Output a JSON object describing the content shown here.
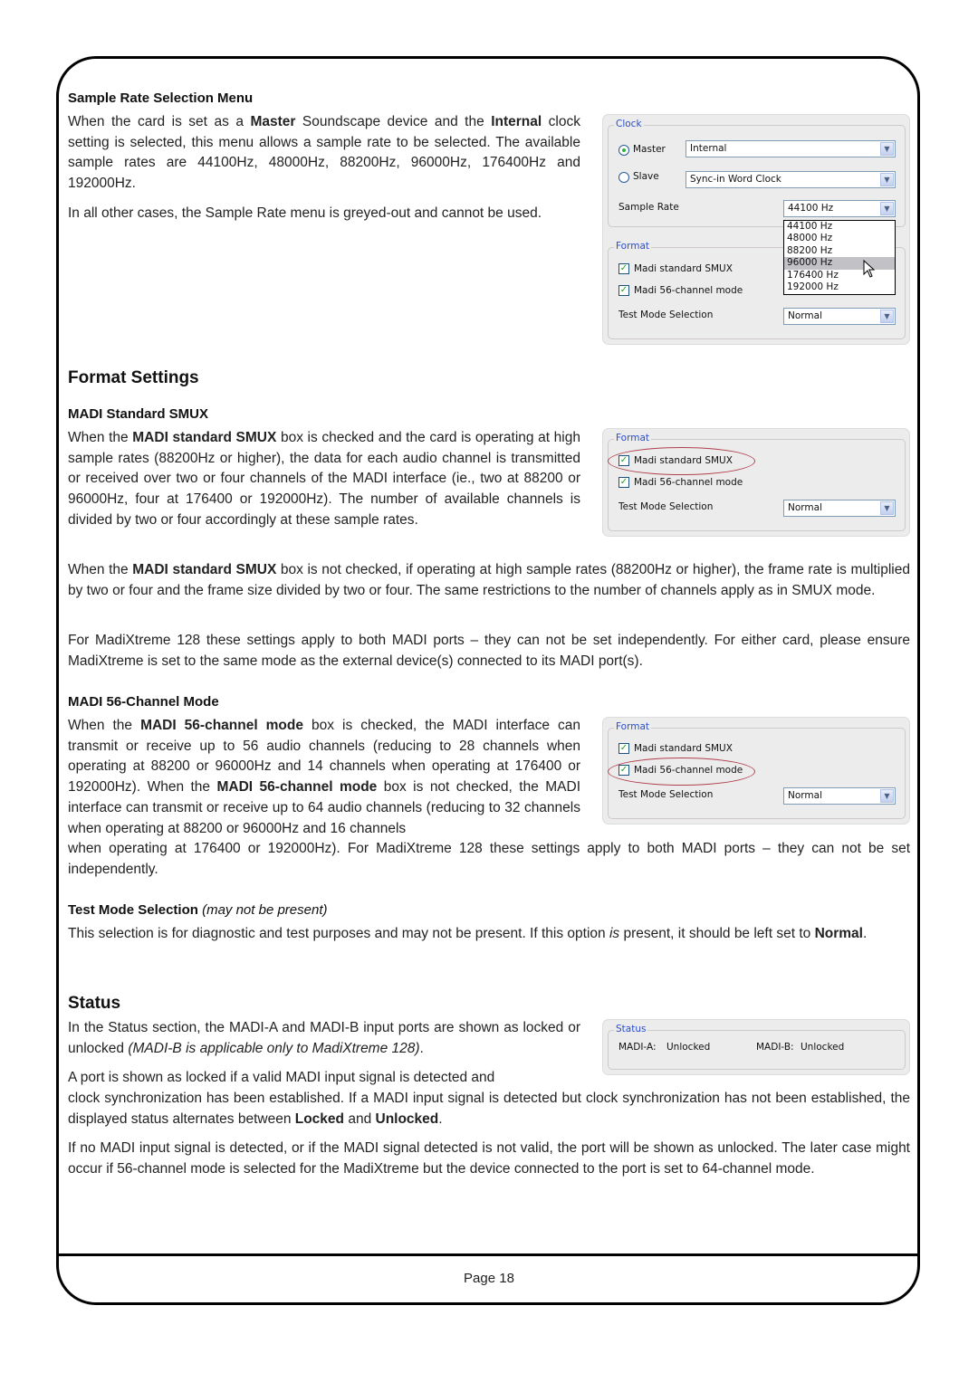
{
  "page": {
    "number_label": "Page 18"
  },
  "sample_rate": {
    "heading": "Sample Rate Selection Menu",
    "para1": {
      "t1": "When the card is set as a ",
      "b1": "Master",
      "t2": " Soundscape device and the ",
      "b2": "Internal",
      "t3": " clock setting is selected, this menu allows a sample rate to be selected. The available sample rates are 44100Hz, 48000Hz, 88200Hz, 96000Hz, 176400Hz and 192000Hz."
    },
    "para2": "In all other cases, the Sample Rate menu is greyed-out and cannot be used."
  },
  "clock_dialog": {
    "clock_group": "Clock",
    "master_label": "Master",
    "master_selected": true,
    "master_value": "Internal",
    "slave_label": "Slave",
    "slave_selected": false,
    "slave_value": "Sync-in Word Clock",
    "sample_rate_label": "Sample Rate",
    "sample_rate_value": "44100 Hz",
    "sample_rate_options": [
      "44100 Hz",
      "48000 Hz",
      "88200 Hz",
      "96000 Hz",
      "176400 Hz",
      "192000 Hz"
    ],
    "highlighted_option": "96000 Hz",
    "format_group": "Format",
    "smux_label": "Madi standard SMUX",
    "smux_checked": true,
    "ch56_label": "Madi 56-channel mode",
    "ch56_checked": true,
    "test_mode_label": "Test Mode Selection",
    "test_mode_value": "Normal"
  },
  "format_settings": {
    "heading": "Format Settings",
    "smux": {
      "heading": "MADI Standard SMUX",
      "para1": {
        "t1": "When the ",
        "b1": "MADI standard SMUX",
        "t2": " box is checked and the card is operating at high sample rates (88200Hz or higher), the data for each audio channel is transmitted or received over two or four channels of the MADI interface (ie., two at 88200 or 96000Hz, four at 176400 or 192000Hz). The number of available channels is divided by two or four accordingly at these sample rates."
      },
      "para2": {
        "t1": "When the ",
        "b1": "MADI standard SMUX",
        "t2": " box is not checked, if operating at high sample rates (88200Hz or higher), the frame rate is multiplied by two or four and the frame size divided by two or four. The same restrictions to the number of channels apply as in SMUX mode."
      },
      "para3": "For MadiXtreme 128 these settings apply to both MADI ports – they can not be set independently. For either card, please ensure MadiXtreme is set to the same mode as the external device(s) connected to its MADI port(s)."
    },
    "ch56": {
      "heading": "MADI 56-Channel Mode",
      "para1": {
        "t1": "When the ",
        "b1": "MADI 56-channel mode",
        "t2": " box is checked, the MADI interface can transmit or receive up to 56 audio channels (reducing to 28 channels when operating at 88200 or 96000Hz and 14 channels when operating at 176400 or 192000Hz). When the ",
        "b2": "MADI 56-channel mode",
        "t3": " box is not checked, the MADI interface can transmit or receive up to 64 audio channels (reducing to 32 channels when operating at 88200 or 96000Hz and 16 channels",
        "t4": "when operating at 176400 or 192000Hz). For MadiXtreme 128 these settings apply to both MADI ports – they can not be set independently."
      }
    },
    "test_mode": {
      "heading": "Test Mode Selection",
      "heading_note": "(may not be present)",
      "para": {
        "t1": "This selection is for diagnostic and test purposes and may not be present. If this option ",
        "i1": "is",
        "t2": " present, it should be left set to ",
        "b1": "Normal",
        "t3": "."
      }
    }
  },
  "format_dialog": {
    "format_group": "Format",
    "smux_label": "Madi standard SMUX",
    "ch56_label": "Madi 56-channel mode",
    "test_mode_label": "Test Mode Selection",
    "test_mode_value": "Normal"
  },
  "status": {
    "heading": "Status",
    "para1": {
      "t1": "In the Status section, the MADI-A and MADI-B input ports are shown as locked or unlocked ",
      "i1": "(MADI-B is applicable only to MadiXtreme 128)",
      "t2": "."
    },
    "para2": {
      "t1": "A port is shown as locked if a valid MADI input signal is detected and",
      "t2": "clock synchronization has been established. If a MADI input signal is detected but clock synchronization has not been established, the displayed status alternates between ",
      "b1": "Locked",
      "t3": " and ",
      "b2": "Unlocked",
      "t4": "."
    },
    "para3": "If no MADI input signal is detected, or if the MADI signal detected is not valid, the port will be shown as unlocked. The later case might occur if 56-channel mode is selected for the MadiXtreme but the device connected to the port is set to 64-channel mode."
  },
  "status_dialog": {
    "group": "Status",
    "madi_a_label": "MADI-A:",
    "madi_a_value": "Unlocked",
    "madi_b_label": "MADI-B:",
    "madi_b_value": "Unlocked"
  },
  "colors": {
    "group_label": "#2a4ed0",
    "highlight_ellipse": "#b0404e",
    "panel_bg": "#ECECEC",
    "check_mark": "#21a121"
  }
}
